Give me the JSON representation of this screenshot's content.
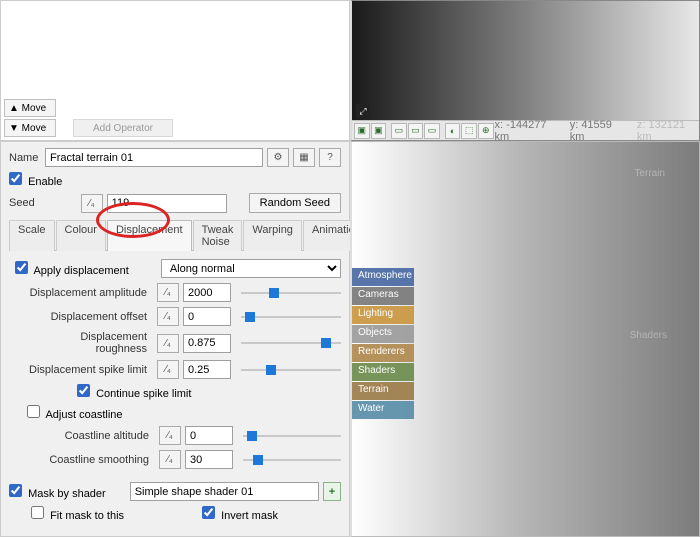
{
  "top_buttons": {
    "move_up": "▲ Move",
    "move_down": "▼ Move",
    "add_op": "Add Operator"
  },
  "statusbar": {
    "x": "x: -144277 km",
    "y": "y: 41559 km",
    "z": "z: 132121 km"
  },
  "name_label": "Name",
  "name_value": "Fractal terrain 01",
  "enable_label": "Enable",
  "seed_label": "Seed",
  "seed_value": "119",
  "random_seed": "Random Seed",
  "tabs": {
    "scale": "Scale",
    "colour": "Colour",
    "displacement": "Displacement",
    "tweak": "Tweak Noise",
    "warping": "Warping",
    "animation": "Animation"
  },
  "apply_disp": "Apply displacement",
  "direction": "Along normal",
  "rows": {
    "amp": {
      "label": "Displacement amplitude",
      "value": "2000",
      "pos": 28
    },
    "off": {
      "label": "Displacement offset",
      "value": "0",
      "pos": 4
    },
    "rough": {
      "label": "Displacement roughness",
      "value": "0.875",
      "pos": 80
    },
    "spike": {
      "label": "Displacement spike limit",
      "value": "0.25",
      "pos": 25
    }
  },
  "cont_spike": "Continue spike limit",
  "adjust_coast": "Adjust coastline",
  "coast": {
    "alt": {
      "label": "Coastline altitude",
      "value": "0",
      "pos": 4
    },
    "smooth": {
      "label": "Coastline smoothing",
      "value": "30",
      "pos": 10
    }
  },
  "mask_label": "Mask by shader",
  "mask_value": "Simple shape shader 01",
  "fit_mask": "Fit mask to this",
  "invert_mask": "Invert mask",
  "cats": {
    "atm": "Atmosphere",
    "cam": "Cameras",
    "lig": "Lighting",
    "obj": "Objects",
    "ren": "Renderers",
    "sha": "Shaders",
    "ter": "Terrain",
    "wat": "Water"
  },
  "ghost": {
    "terrain": "Terrain",
    "shaders": "Shaders"
  }
}
